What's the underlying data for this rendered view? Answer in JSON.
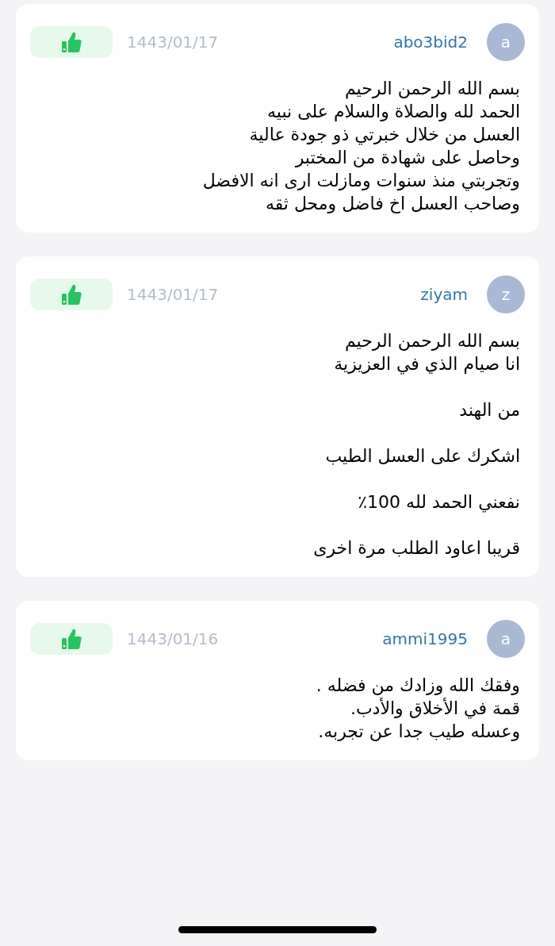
{
  "comments": [
    {
      "avatar": "a",
      "username": "abo3bid2",
      "date": "1443/01/17",
      "paragraphs": [
        "بسم الله الرحمن الرحيم\nالحمد لله والصلاة والسلام على نبيه\nالعسل من خلال خبرتي ذو جودة عالية\nوحاصل على شهادة من المختبر\nوتجربتي منذ سنوات ومازلت ارى انه الافضل\nوصاحب العسل اخ فاضل ومحل ثقه"
      ]
    },
    {
      "avatar": "z",
      "username": "ziyam",
      "date": "1443/01/17",
      "paragraphs": [
        "بسم الله الرحمن الرحيم\nانا صيام الذي في العزيزية",
        "من الهند",
        "اشكرك على العسل الطيب",
        "نفعني الحمد لله 100٪",
        "قريبا اعاود الطلب مرة اخرى"
      ]
    },
    {
      "avatar": "a",
      "username": "ammi1995",
      "date": "1443/01/16",
      "paragraphs": [
        "وفقك الله وزادك من فضله .\nقمة في الأخلاق والأدب.\nوعسله طيب جدا عن تجربه."
      ]
    }
  ]
}
